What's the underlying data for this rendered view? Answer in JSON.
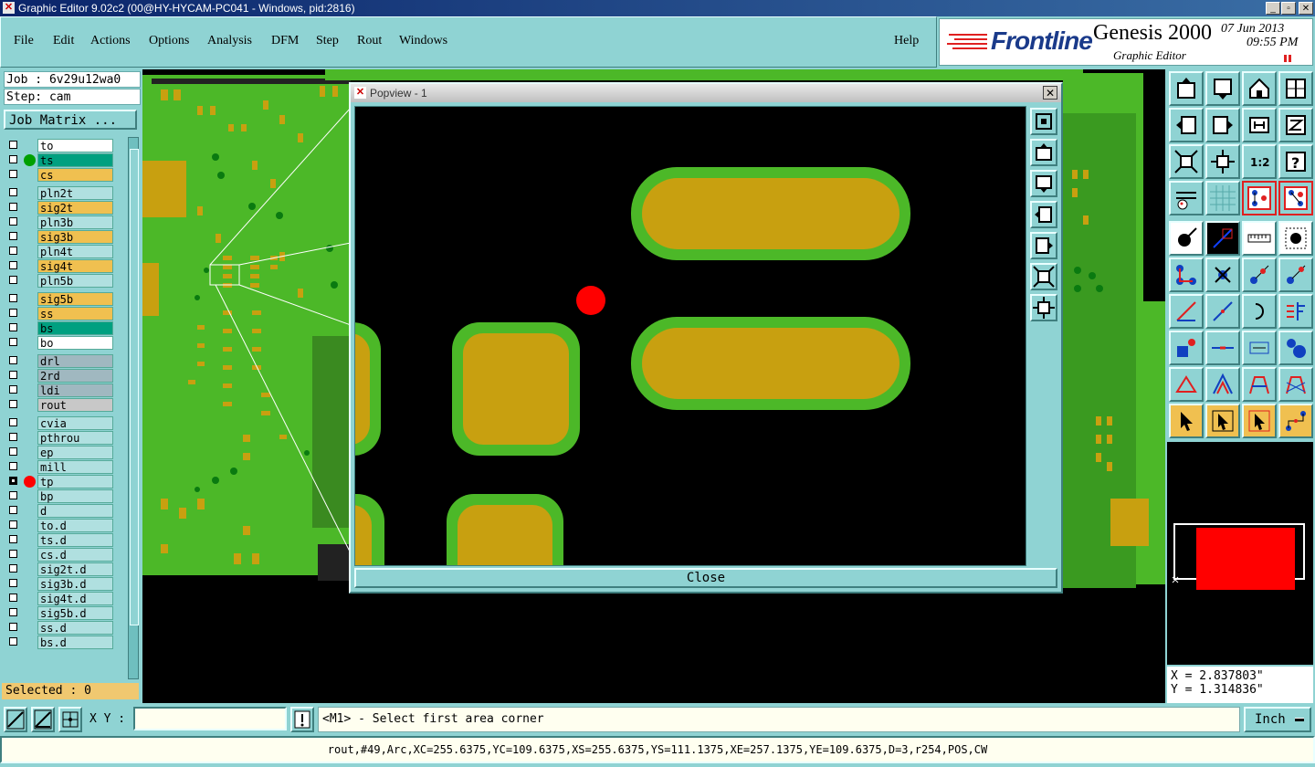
{
  "window": {
    "title": "Graphic Editor 9.02c2 (00@HY-HYCAM-PC041 - Windows, pid:2816)",
    "controls": [
      "_",
      "▫",
      "✕"
    ]
  },
  "menu": {
    "items": [
      "File",
      "Edit",
      "Actions",
      "Options",
      "Analysis",
      "DFM",
      "Step",
      "Rout",
      "Windows"
    ],
    "help": "Help"
  },
  "brand": {
    "logo": "Frontline",
    "product": "Genesis 2000",
    "subtitle": "Graphic Editor",
    "date": "07 Jun 2013",
    "time": "09:55 PM"
  },
  "job": {
    "job_line": "Job : 6v29u12wa0",
    "step_line": "Step: cam",
    "job_matrix_label": "Job Matrix ..."
  },
  "layers": [
    {
      "name": "to",
      "color": "#ffffff",
      "dot": ""
    },
    {
      "name": "ts",
      "color": "#00a080",
      "dot": "#00a000"
    },
    {
      "name": "cs",
      "color": "#f0c050",
      "dot": ""
    },
    {
      "name": "pln2t",
      "color": "#b0e0e0",
      "dot": ""
    },
    {
      "name": "sig2t",
      "color": "#f0c050",
      "dot": ""
    },
    {
      "name": "pln3b",
      "color": "#b0e0e0",
      "dot": ""
    },
    {
      "name": "sig3b",
      "color": "#f0c050",
      "dot": ""
    },
    {
      "name": "pln4t",
      "color": "#b0e0e0",
      "dot": ""
    },
    {
      "name": "sig4t",
      "color": "#f0c050",
      "dot": ""
    },
    {
      "name": "pln5b",
      "color": "#b0e0e0",
      "dot": ""
    },
    {
      "name": "sig5b",
      "color": "#f0c050",
      "dot": ""
    },
    {
      "name": "ss",
      "color": "#f0c050",
      "dot": ""
    },
    {
      "name": "bs",
      "color": "#00a080",
      "dot": ""
    },
    {
      "name": "bo",
      "color": "#ffffff",
      "dot": ""
    },
    {
      "name": "drl",
      "color": "#a0b8c0",
      "dot": ""
    },
    {
      "name": "2rd",
      "color": "#a0b8c0",
      "dot": ""
    },
    {
      "name": "ldi",
      "color": "#a0b8c0",
      "dot": ""
    },
    {
      "name": "rout",
      "color": "#c8c8c8",
      "dot": ""
    },
    {
      "name": "cvia",
      "color": "#b0e0e0",
      "dot": ""
    },
    {
      "name": "pthrou",
      "color": "#b0e0e0",
      "dot": ""
    },
    {
      "name": "ep",
      "color": "#b0e0e0",
      "dot": ""
    },
    {
      "name": "mill",
      "color": "#b0e0e0",
      "dot": ""
    },
    {
      "name": "tp",
      "color": "#b0e0e0",
      "dot": "#ff0000"
    },
    {
      "name": "bp",
      "color": "#b0e0e0",
      "dot": ""
    },
    {
      "name": "d",
      "color": "#b0e0e0",
      "dot": ""
    },
    {
      "name": "to.d",
      "color": "#b0e0e0",
      "dot": ""
    },
    {
      "name": "ts.d",
      "color": "#b0e0e0",
      "dot": ""
    },
    {
      "name": "cs.d",
      "color": "#b0e0e0",
      "dot": ""
    },
    {
      "name": "sig2t.d",
      "color": "#b0e0e0",
      "dot": ""
    },
    {
      "name": "sig3b.d",
      "color": "#b0e0e0",
      "dot": ""
    },
    {
      "name": "sig4t.d",
      "color": "#b0e0e0",
      "dot": ""
    },
    {
      "name": "sig5b.d",
      "color": "#b0e0e0",
      "dot": ""
    },
    {
      "name": "ss.d",
      "color": "#b0e0e0",
      "dot": ""
    },
    {
      "name": "bs.d",
      "color": "#b0e0e0",
      "dot": ""
    }
  ],
  "selected": "Selected : 0",
  "popview": {
    "title": "Popview - 1",
    "close_label": "Close"
  },
  "coords": {
    "x": "X = 2.837803\"",
    "y": "Y = 1.314836\""
  },
  "bottom": {
    "xy_label": "X Y :",
    "xy_value": "",
    "message": "<M1> - Select first area corner",
    "unit": "Inch"
  },
  "status": "rout,#49,Arc,XC=255.6375,YC=109.6375,XS=255.6375,YS=111.1375,XE=257.1375,YE=109.6375,D=3,r254,POS,CW",
  "colors": {
    "pcb_green": "#4cb828",
    "pad_gold": "#c8a010",
    "panel_teal": "#8fd3d3",
    "highlight_red": "#ff0000"
  }
}
